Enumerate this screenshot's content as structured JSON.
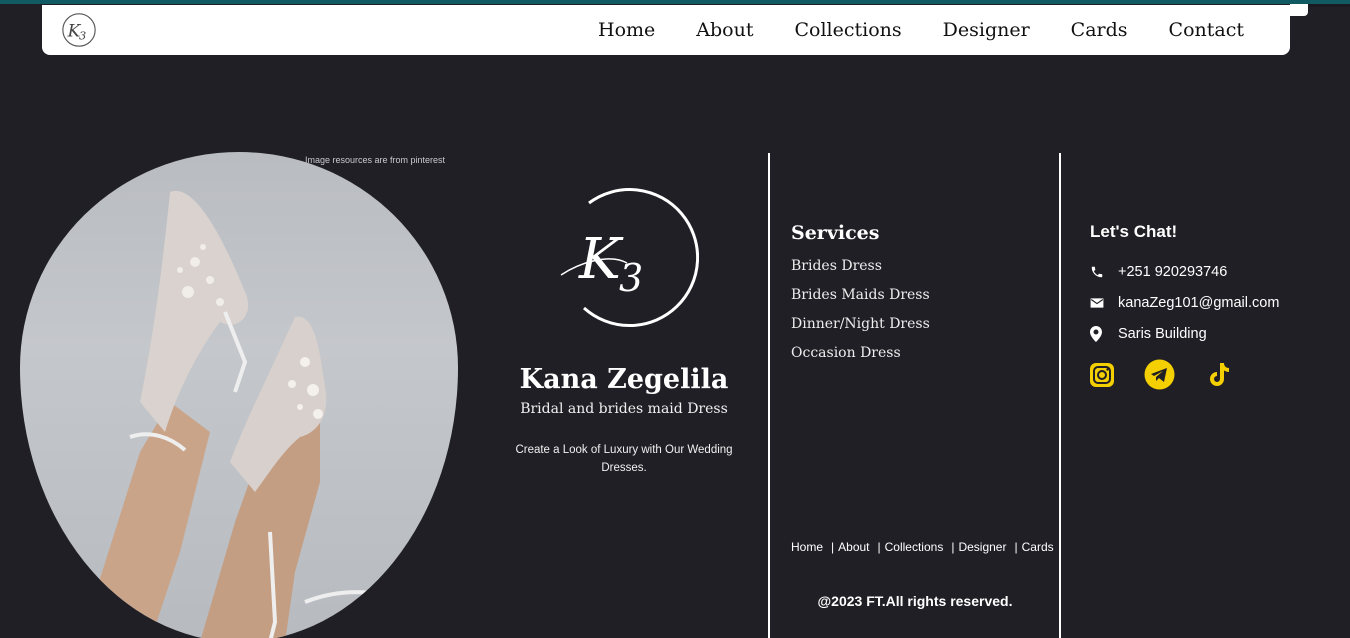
{
  "nav": {
    "logo_alt": "K3",
    "links": [
      "Home",
      "About",
      "Collections",
      "Designer",
      "Cards",
      "Contact"
    ]
  },
  "hero": {
    "image_credit": "Image resources are from pinterest"
  },
  "brand": {
    "name": "Kana Zegelila",
    "subtitle": "Bridal and brides maid Dress",
    "tagline": "Create a Look of Luxury with Our Wedding Dresses."
  },
  "services": {
    "title": "Services",
    "items": [
      "Brides Dress",
      "Brides Maids Dress",
      "Dinner/Night Dress",
      "Occasion Dress"
    ]
  },
  "footer": {
    "links": [
      "Home",
      "About",
      "Collections",
      "Designer",
      "Cards"
    ],
    "copyright": "@2023 FT.All rights reserved."
  },
  "contact": {
    "title": "Let's Chat!",
    "phone": "+251 920293746",
    "email": "kanaZeg101@gmail.com",
    "address": "Saris Building",
    "icons": [
      "phone-icon",
      "mail-icon",
      "location-icon"
    ]
  },
  "social": {
    "icons": [
      "instagram-icon",
      "telegram-icon",
      "tiktok-icon"
    ]
  },
  "colors": {
    "background": "#201f26",
    "accent_yellow": "#f5d000",
    "top_line": "#0f5a63"
  }
}
